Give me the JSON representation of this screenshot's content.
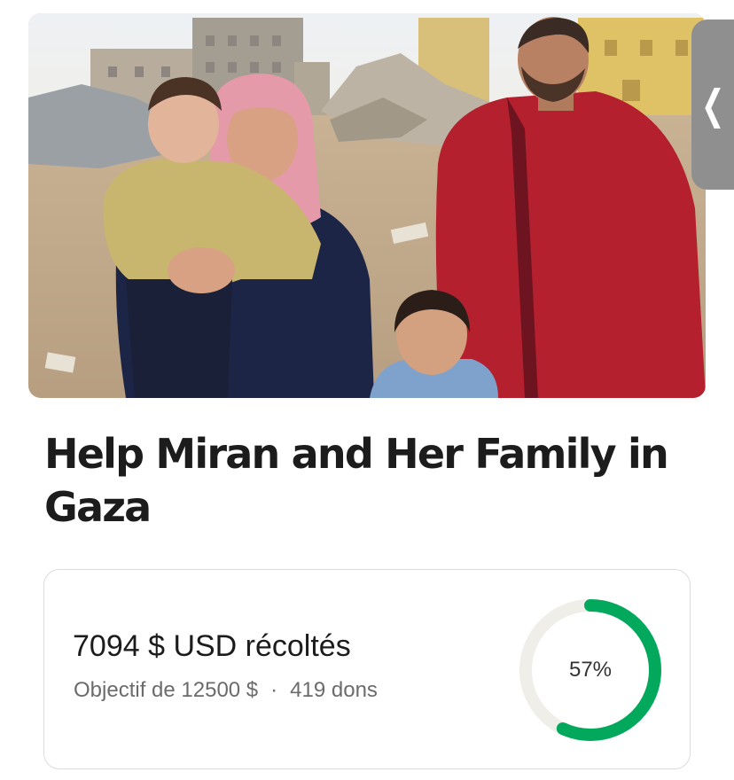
{
  "campaign": {
    "title": "Help Miran and Her Family in Gaza",
    "photo_icon": "family-photo"
  },
  "side_tab": {
    "icon": "chevron-left-icon",
    "glyph": "❮"
  },
  "progress": {
    "raised_label": "7094 $ USD récoltés",
    "goal_label": "Objectif de 12500 $",
    "separator": "·",
    "donations_label": "419 dons",
    "percent_label": "57%",
    "percent_value": 0.57
  },
  "colors": {
    "accent": "#02a95c",
    "track": "#f0eee8",
    "title": "#1c1c1c",
    "muted": "#6b6b6b"
  }
}
